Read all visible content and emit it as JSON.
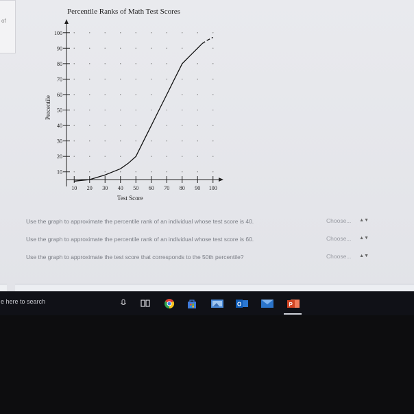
{
  "side_panel": {
    "text": "of"
  },
  "chart_data": {
    "type": "line",
    "title": "Percentile Ranks of Math Test Scores",
    "xlabel": "Test Score",
    "ylabel": "Percentile",
    "x_ticks": [
      "10",
      "20",
      "30",
      "40",
      "50",
      "60",
      "70",
      "80",
      "90",
      "100"
    ],
    "y_ticks": [
      "10",
      "20",
      "30",
      "40",
      "50",
      "60",
      "70",
      "80",
      "90",
      "100"
    ],
    "xlim": [
      5,
      105
    ],
    "ylim": [
      5,
      103
    ],
    "series": [
      {
        "style": "solid",
        "x": [
          10,
          20,
          30,
          40,
          45,
          50,
          55,
          60,
          65,
          70,
          75,
          80,
          85,
          90,
          93
        ],
        "y": [
          4,
          5,
          8,
          12,
          15.5,
          20,
          30,
          40,
          50,
          60,
          70,
          80,
          85,
          90,
          93
        ]
      },
      {
        "style": "dashed",
        "x": [
          93,
          96,
          100
        ],
        "y": [
          93,
          95,
          97
        ]
      }
    ],
    "grid": "dotted",
    "legend": "none"
  },
  "questions": [
    {
      "text": "Use the graph to approximate the percentile rank of an individual whose test score is 40.",
      "select": "Choose..."
    },
    {
      "text": "Use the graph to approximate the percentile rank of an individual whose test score is 60.",
      "select": "Choose..."
    },
    {
      "text": "Use the graph to approximate the test score that corresponds to the 50th percentile?",
      "select": "Choose..."
    }
  ],
  "taskbar": {
    "search_text": "e here to search",
    "icons": [
      "microphone-icon",
      "task-view-icon",
      "chrome-icon",
      "store-icon",
      "photos-icon",
      "outlook-icon",
      "mail-icon",
      "powerpoint-icon"
    ]
  }
}
